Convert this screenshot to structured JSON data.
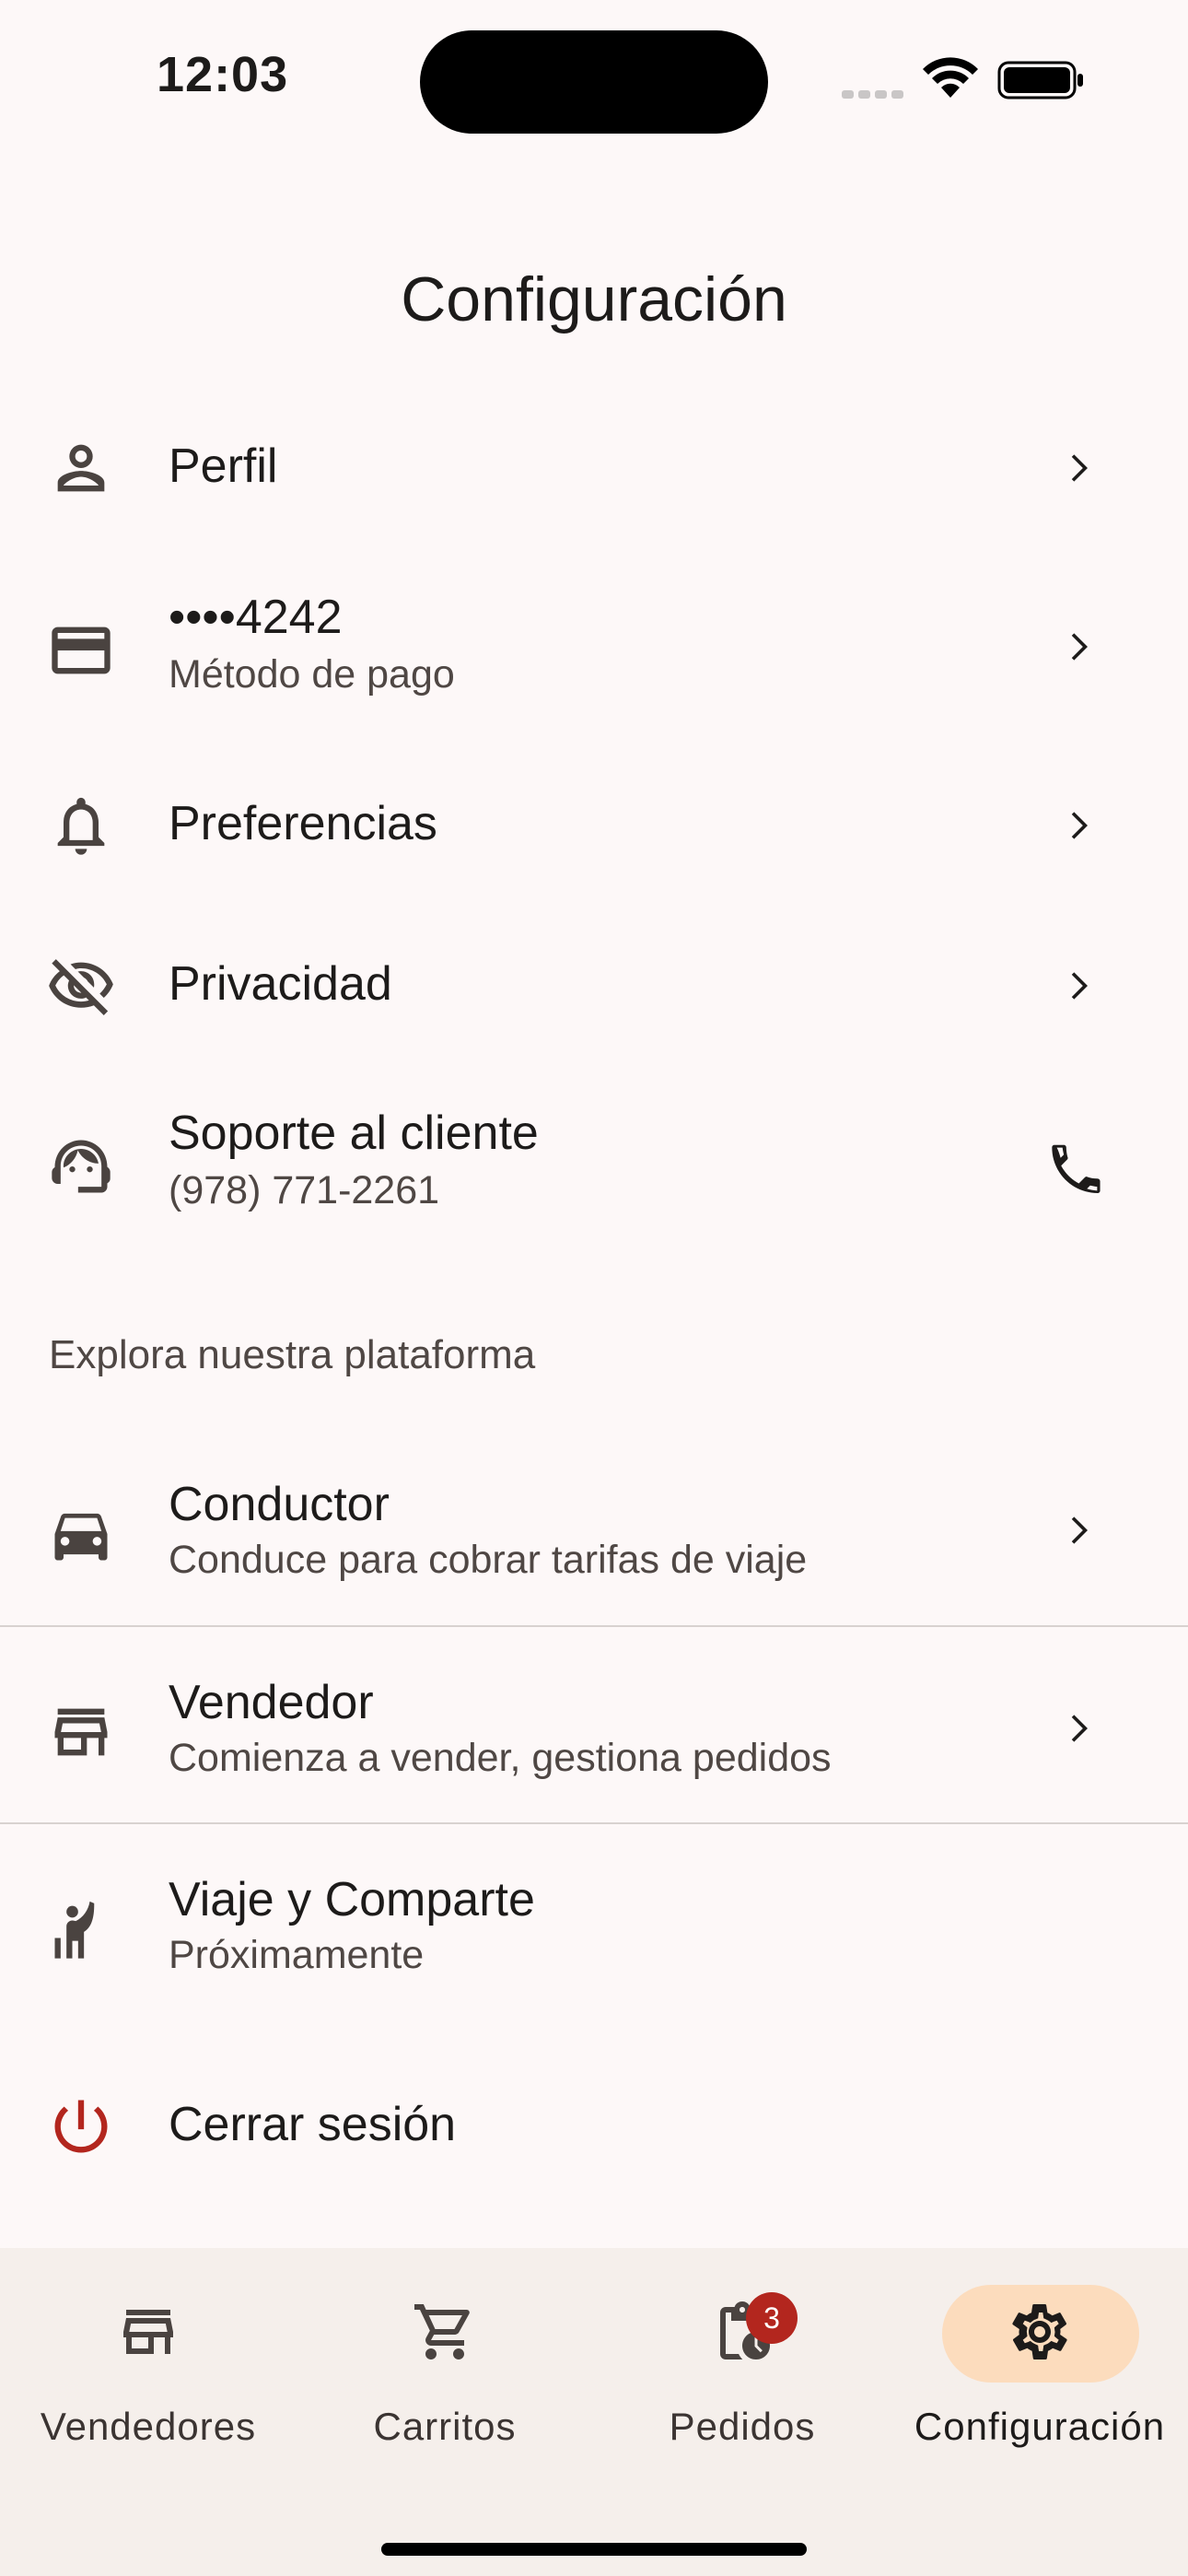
{
  "status": {
    "time": "12:03"
  },
  "page": {
    "title": "Configuración"
  },
  "settings": {
    "profile": {
      "label": "Perfil",
      "icon": "person-icon"
    },
    "payment": {
      "label": "••••4242",
      "sublabel": "Método de pago",
      "icon": "credit-card-icon"
    },
    "preferences": {
      "label": "Preferencias",
      "icon": "bell-icon"
    },
    "privacy": {
      "label": "Privacidad",
      "icon": "eye-off-icon"
    },
    "support": {
      "label": "Soporte al cliente",
      "sublabel": "(978) 771-2261",
      "icon": "support-agent-icon",
      "action_icon": "phone-icon"
    }
  },
  "explore": {
    "section_label": "Explora nuestra plataforma",
    "driver": {
      "label": "Conductor",
      "sublabel": "Conduce para cobrar tarifas de viaje",
      "icon": "car-icon"
    },
    "seller": {
      "label": "Vendedor",
      "sublabel": "Comienza a vender, gestiona pedidos",
      "icon": "storefront-icon"
    },
    "trip_share": {
      "label": "Viaje y Comparte",
      "sublabel": "Próximamente",
      "icon": "hail-person-icon"
    }
  },
  "logout": {
    "label": "Cerrar sesión",
    "icon": "power-icon",
    "color": "#b3261e"
  },
  "bottom_nav": {
    "items": [
      {
        "label": "Vendedores",
        "icon": "storefront-icon"
      },
      {
        "label": "Carritos",
        "icon": "cart-icon"
      },
      {
        "label": "Pedidos",
        "icon": "orders-history-icon",
        "badge": "3"
      },
      {
        "label": "Configuración",
        "icon": "gear-icon",
        "active": true
      }
    ]
  },
  "colors": {
    "background": "#fdf8f8",
    "nav_background": "#f5efeb",
    "active_pill": "#fcdcbd",
    "badge": "#b3261e"
  }
}
